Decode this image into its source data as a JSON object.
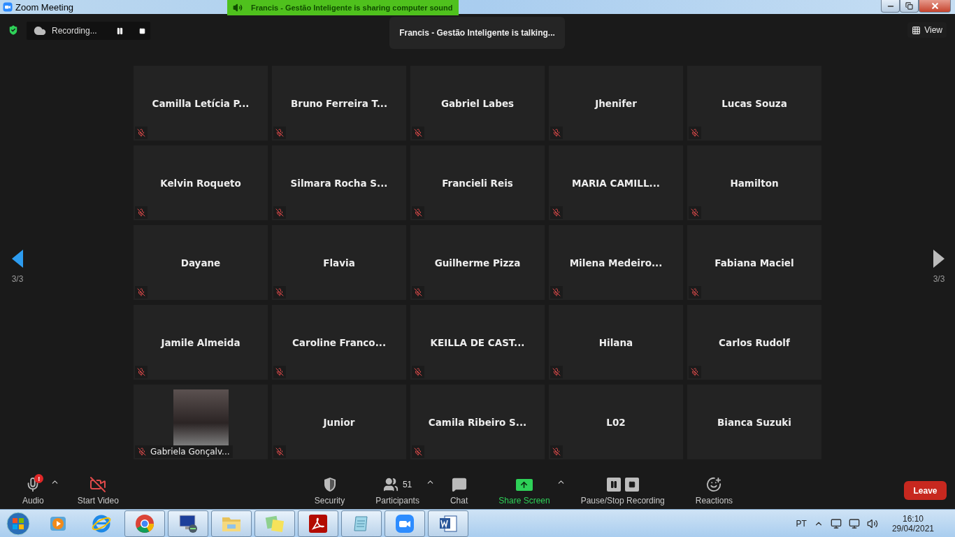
{
  "window": {
    "title": "Zoom Meeting"
  },
  "sharing_banner": {
    "text": "Francis - Gestão Inteligente is sharing computer sound"
  },
  "recording": {
    "label": "Recording..."
  },
  "talking_toast": {
    "text": "Francis - Gestão Inteligente is talking..."
  },
  "view_button": {
    "label": "View"
  },
  "pager": [
    {
      "label": "3/3",
      "highlighted": true
    },
    {
      "label": "3/3",
      "highlighted": false
    }
  ],
  "tiles": [
    {
      "name": "Camilla  Letícia P...",
      "kind": "name",
      "muted": true
    },
    {
      "name": "Bruno  Ferreira  T...",
      "kind": "name",
      "muted": true
    },
    {
      "name": "Gabriel Labes",
      "kind": "name",
      "muted": true
    },
    {
      "name": "Jhenifer",
      "kind": "name",
      "muted": true
    },
    {
      "name": "Lucas Souza",
      "kind": "name",
      "muted": true
    },
    {
      "name": "Kelvin Roqueto",
      "kind": "name",
      "muted": true
    },
    {
      "name": "Silmara  Rocha  S...",
      "kind": "name",
      "muted": true
    },
    {
      "name": "Francieli Reis",
      "kind": "name",
      "muted": true
    },
    {
      "name": "MARIA  CAMILL...",
      "kind": "name",
      "muted": true
    },
    {
      "name": "Hamilton",
      "kind": "name",
      "muted": true
    },
    {
      "name": "Dayane",
      "kind": "name",
      "muted": true
    },
    {
      "name": "Flavia",
      "kind": "name",
      "muted": true
    },
    {
      "name": "Guilherme Pizza",
      "kind": "name",
      "muted": true
    },
    {
      "name": "Milena  Medeiro...",
      "kind": "name",
      "muted": true
    },
    {
      "name": "Fabiana Maciel",
      "kind": "name",
      "muted": true
    },
    {
      "name": "Jamile Almeida",
      "kind": "name",
      "muted": true
    },
    {
      "name": "Caroline  Franco...",
      "kind": "name",
      "muted": true
    },
    {
      "name": "KEILLA DE CAST...",
      "kind": "name",
      "muted": true
    },
    {
      "name": "Hilana",
      "kind": "name",
      "muted": true
    },
    {
      "name": "Carlos Rudolf",
      "kind": "name",
      "muted": true
    },
    {
      "name": "Gabriela Gonçalv...",
      "kind": "video",
      "muted": true
    },
    {
      "name": "Junior",
      "kind": "name",
      "muted": true
    },
    {
      "name": "Camila  Ribeiro  S...",
      "kind": "name",
      "muted": true
    },
    {
      "name": "L02",
      "kind": "name",
      "muted": true
    },
    {
      "name": "Bianca Suzuki",
      "kind": "name",
      "muted": false
    }
  ],
  "toolbar": [
    {
      "kind": "audio",
      "label": "Audio",
      "alert": "!",
      "caret": true,
      "accent": false
    },
    {
      "kind": "video",
      "label": "Start Video",
      "caret": false,
      "accent": false
    },
    {
      "kind": "security",
      "label": "Security",
      "caret": false,
      "accent": false
    },
    {
      "kind": "participants",
      "label": "Participants",
      "count": "51",
      "caret": true,
      "accent": false
    },
    {
      "kind": "chat",
      "label": "Chat",
      "caret": false,
      "accent": false
    },
    {
      "kind": "share",
      "label": "Share Screen",
      "caret": true,
      "accent": true
    },
    {
      "kind": "recording",
      "label": "Pause/Stop Recording",
      "caret": false,
      "accent": false
    },
    {
      "kind": "reactions",
      "label": "Reactions",
      "caret": false,
      "accent": false
    }
  ],
  "leave_button": {
    "label": "Leave"
  },
  "taskbar": {
    "apps": [
      {
        "kind": "media-player",
        "open": false
      },
      {
        "kind": "browser-e",
        "open": false
      },
      {
        "kind": "browser-circle",
        "open": true
      },
      {
        "kind": "remote-desktop",
        "open": true
      },
      {
        "kind": "folder",
        "open": true
      },
      {
        "kind": "sticky-notes",
        "open": true
      },
      {
        "kind": "pdf",
        "open": true
      },
      {
        "kind": "notepad",
        "open": true
      },
      {
        "kind": "video-app",
        "open": true
      },
      {
        "kind": "word",
        "open": true
      }
    ],
    "language": "PT",
    "time": "16:10",
    "date": "29/04/2021"
  }
}
